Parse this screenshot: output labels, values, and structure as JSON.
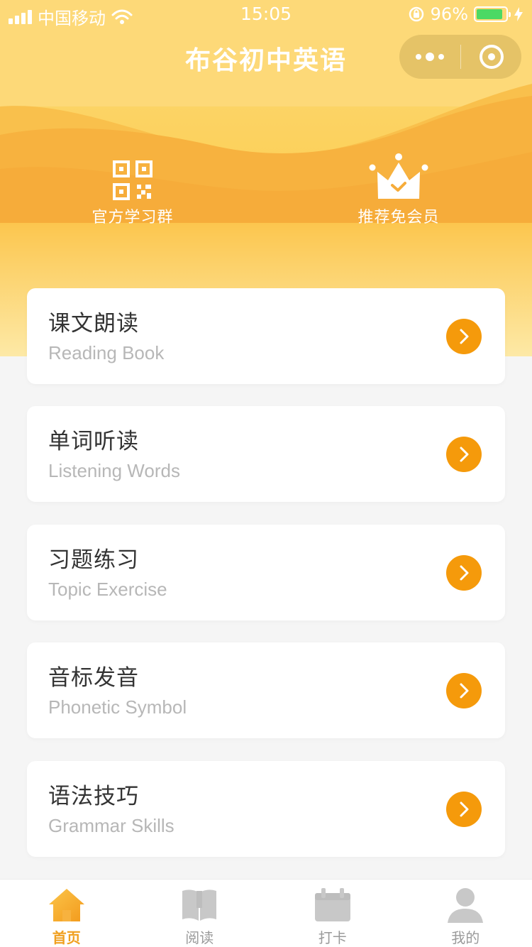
{
  "status_bar": {
    "carrier": "中国移动",
    "time": "15:05",
    "battery": "96%",
    "battery_level": 0.96
  },
  "nav": {
    "title": "布谷初中英语",
    "more_icon": "more-dots-icon",
    "close_icon": "miniprogram-close-icon"
  },
  "quick_actions": [
    {
      "label": "官方学习群",
      "icon": "qrcode-icon"
    },
    {
      "label": "推荐免会员",
      "icon": "crown-icon"
    }
  ],
  "menu": [
    {
      "title": "课文朗读",
      "subtitle": "Reading Book"
    },
    {
      "title": "单词听读",
      "subtitle": "Listening Words"
    },
    {
      "title": "习题练习",
      "subtitle": "Topic Exercise"
    },
    {
      "title": "音标发音",
      "subtitle": "Phonetic Symbol"
    },
    {
      "title": "语法技巧",
      "subtitle": "Grammar Skills"
    }
  ],
  "tabbar": [
    {
      "label": "首页",
      "icon": "home-icon",
      "active": true
    },
    {
      "label": "阅读",
      "icon": "book-icon",
      "active": false
    },
    {
      "label": "打卡",
      "icon": "calendar-icon",
      "active": false
    },
    {
      "label": "我的",
      "icon": "user-icon",
      "active": false
    }
  ],
  "colors": {
    "accent": "#f59a0b",
    "header_top": "#fdd978",
    "wave_orange": "#f6ac3a",
    "tab_active": "#f0a020",
    "tab_inactive": "#c8c8c8"
  }
}
